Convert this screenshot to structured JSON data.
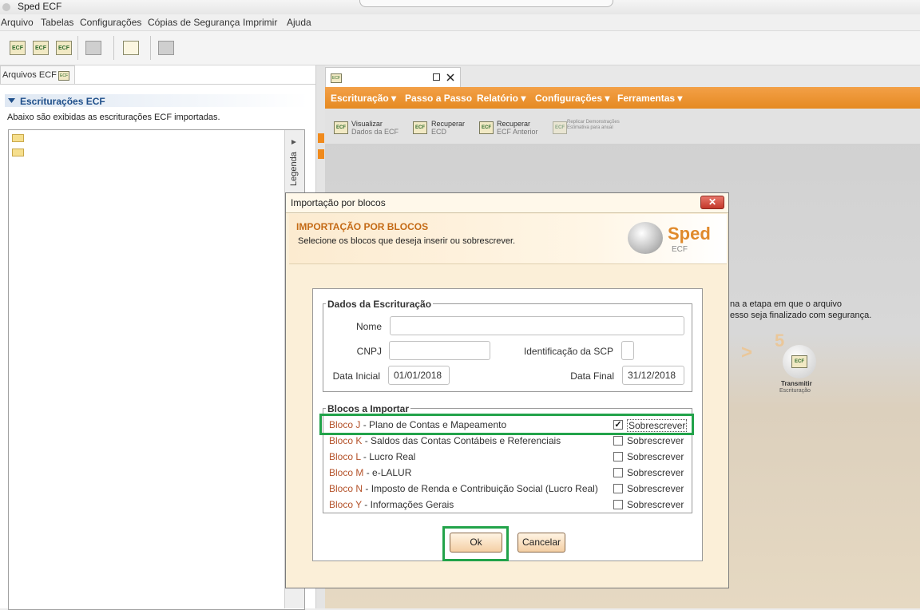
{
  "window": {
    "title": "Sped ECF"
  },
  "menubar": [
    "Arquivo",
    "Tabelas",
    "Configurações",
    "Cópias de Segurança",
    "Imprimir",
    "Ajuda"
  ],
  "toolbar_icons": [
    "ecf-new-icon",
    "ecf-import-icon",
    "ecf-delete-icon",
    "lock-icon",
    "checklist-edit-icon",
    "print-icon",
    "close-x-icon"
  ],
  "left_panel": {
    "tab_label": "Arquivos ECF",
    "section_title": "Escriturações ECF",
    "section_desc": "Abaixo são exibidas as escriturações ECF importadas.",
    "legenda": "Legenda"
  },
  "right_menu": [
    "Escrituração ▾",
    "Passo a Passo",
    "Relatório ▾",
    "Configurações ▾",
    "Ferramentas ▾"
  ],
  "right_toolbar": [
    {
      "line1": "Visualizar",
      "line2": "Dados da ECF"
    },
    {
      "line1": "Recuperar",
      "line2": "ECD"
    },
    {
      "line1": "Recuperar",
      "line2": "ECF Anterior"
    },
    {
      "line1": "Replicar Demonstrações",
      "line2": "Estimativa para anual"
    }
  ],
  "background": {
    "text1": "na a etapa em que o arquivo",
    "text2": "esso seja finalizado com segurança.",
    "step_number": "5",
    "step_title": "Transmitir",
    "step_sub": "Escrituração"
  },
  "dialog": {
    "title": "Importação por blocos",
    "header_title": "IMPORTAÇÃO POR BLOCOS",
    "header_sub": "Selecione os blocos que deseja inserir ou sobrescrever.",
    "logo_word": "Sped",
    "logo_sub": "ECF",
    "dados_title": "Dados da Escrituração",
    "nome_label": "Nome",
    "nome_value": "",
    "cnpj_label": "CNPJ",
    "cnpj_value": "",
    "scp_label": "Identificação da SCP",
    "scp_value": "",
    "data_inicial_label": "Data Inicial",
    "data_inicial_value": "01/01/2018",
    "data_final_label": "Data Final",
    "data_final_value": "31/12/2018",
    "blocos_title": "Blocos a Importar",
    "blocos": [
      {
        "code": "Bloco J",
        "desc": " - Plano de Contas e Mapeamento",
        "checked": true,
        "option": "Sobrescrever"
      },
      {
        "code": "Bloco K",
        "desc": " - Saldos das Contas Contábeis e Referenciais",
        "checked": false,
        "option": "Sobrescrever"
      },
      {
        "code": "Bloco L",
        "desc": " - Lucro Real",
        "checked": false,
        "option": "Sobrescrever"
      },
      {
        "code": "Bloco M",
        "desc": " - e-LALUR",
        "checked": false,
        "option": "Sobrescrever"
      },
      {
        "code": "Bloco N",
        "desc": " - Imposto de Renda e Contribuição Social (Lucro Real)",
        "checked": false,
        "option": "Sobrescrever"
      },
      {
        "code": "Bloco Y",
        "desc": " - Informações Gerais",
        "checked": false,
        "option": "Sobrescrever"
      }
    ],
    "ok_label": "Ok",
    "cancel_label": "Cancelar"
  },
  "colors": {
    "accent_orange": "#e58a22",
    "highlight_green": "#22a34a",
    "bloco_code": "#b4522a"
  }
}
